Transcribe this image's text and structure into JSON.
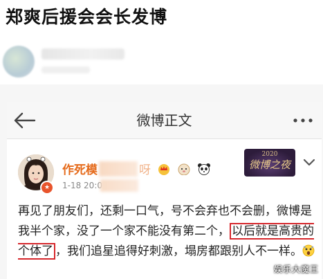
{
  "headline": "郑爽后援会会长发博",
  "navbar": {
    "title": "微博正文"
  },
  "post": {
    "author_name": "作死模",
    "author_name_tail": "呀",
    "time": "1-18 20:0",
    "event_badge": {
      "year": "2020",
      "name": "微博之夜"
    },
    "text_before": "再见了朋友们，还剩一口气，号不会弃也不会删，微博是我半个家，没了一个家不能没有第二个，",
    "text_highlight": "以后就是高贵的个体了",
    "text_after": "，我们追星追得好刺激，塌房都跟别人不一样。"
  },
  "watermark": "娱乐大魔王",
  "colors": {
    "author": "#e56a1a",
    "highlight_box": "#d6262b",
    "event_badge_bg": "#3a2650"
  }
}
